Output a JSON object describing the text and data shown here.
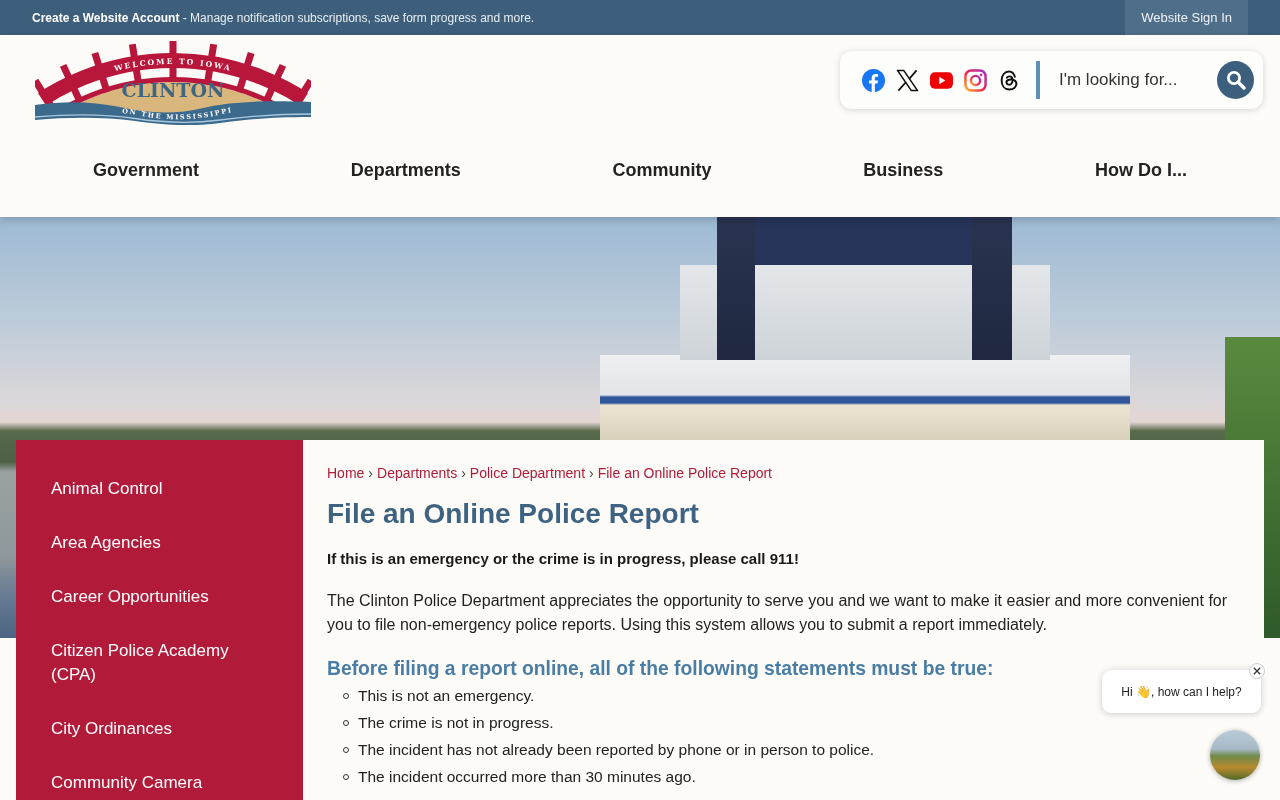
{
  "top_bar": {
    "account_link": "Create a Website Account",
    "account_note": "- Manage notification subscriptions, save form progress and more.",
    "sign_in": "Website Sign In"
  },
  "header": {
    "logo": {
      "top_text": "WELCOME TO IOWA",
      "name": "CLINTON",
      "bottom_text": "ON THE MISSISSIPPI"
    },
    "social_links": [
      {
        "kind": "facebook"
      },
      {
        "kind": "x"
      },
      {
        "kind": "youtube"
      },
      {
        "kind": "instagram"
      },
      {
        "kind": "threads"
      }
    ],
    "search": {
      "placeholder": "I'm looking for..."
    }
  },
  "nav": [
    "Government",
    "Departments",
    "Community",
    "Business",
    "How Do I..."
  ],
  "sidebar": {
    "items": [
      "Animal Control",
      "Area Agencies",
      "Career Opportunities",
      "Citizen Police Academy (CPA)",
      "City Ordinances",
      "Community Camera"
    ]
  },
  "breadcrumb": [
    {
      "label": "Home"
    },
    {
      "separator": "›",
      "label": "Departments"
    },
    {
      "separator": "›",
      "label": "Police Department"
    },
    {
      "separator": "›",
      "label": "File an Online Police Report"
    }
  ],
  "content": {
    "title": "File an Online Police Report",
    "alert": "If this is an emergency or the crime is in progress, please call 911!",
    "intro": "The Clinton Police Department appreciates the opportunity to serve you and we want to make it easier and more convenient for you to file non-emergency police reports. Using this system allows you to submit a report immediately.",
    "requirements_heading": "Before filing a report online, all of the following statements must be true:",
    "requirements": [
      "This is not an emergency.",
      "The crime is not in progress.",
      "The incident has not already been reported by phone or in person to police.",
      "The incident occurred more than 30 minutes ago."
    ]
  },
  "chat": {
    "greeting": "Hi 👋, how can I help?"
  }
}
